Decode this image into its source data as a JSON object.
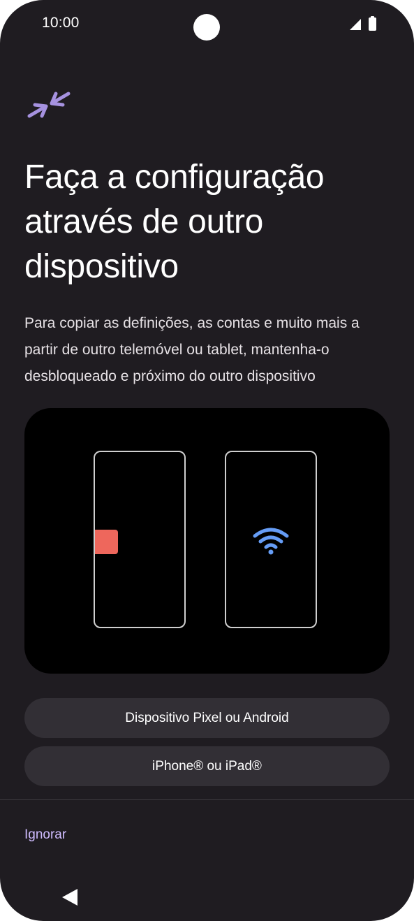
{
  "status_bar": {
    "time": "10:00",
    "icons": [
      "signal-icon",
      "battery-icon"
    ]
  },
  "header": {
    "icon": "swap-arrows-icon",
    "icon_color": "#a692e0",
    "title": "Faça a configuração através de outro dispositivo",
    "subtitle": "Para copiar as definições, as contas e muito mais a partir de outro telemóvel ou tablet, mantenha-o desbloqueado e próximo do outro dispositivo"
  },
  "illustration": {
    "left_phone_icon": "red-square",
    "right_phone_icon": "wifi-icon",
    "accent_red": "#ee675c",
    "accent_blue": "#669df6"
  },
  "actions": {
    "android_button": "Dispositivo Pixel ou Android",
    "iphone_button": "iPhone® ou iPad®"
  },
  "footer": {
    "skip_label": "Ignorar",
    "nav_icon": "back-triangle-icon"
  }
}
